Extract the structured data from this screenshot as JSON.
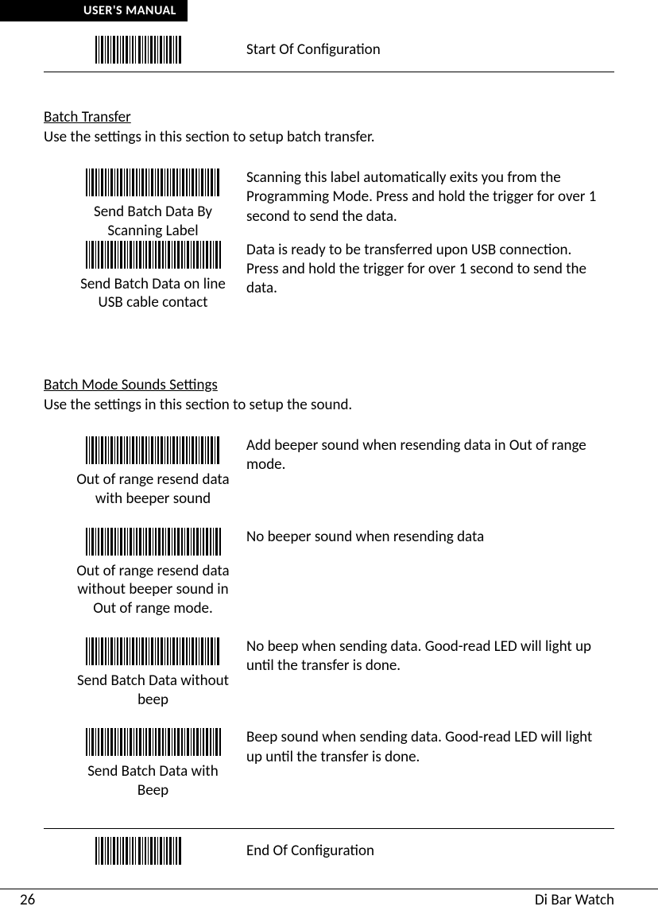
{
  "header": {
    "tab": "USER'S MANUAL"
  },
  "startConfig": {
    "label": "Start Of Configuration"
  },
  "section1": {
    "heading": "Batch Transfer",
    "desc": "Use the settings in this section to setup batch transfer.",
    "items": [
      {
        "caption": "Send Batch Data By Scanning Label",
        "desc": "Scanning this label automatically exits you from the Programming Mode. Press and hold the trigger for over 1 second to send the data."
      },
      {
        "caption": "Send Batch Data on line USB cable contact",
        "desc": "Data is ready to be transferred upon USB connection. Press and hold the trigger for over 1 second to send the data."
      }
    ]
  },
  "section2": {
    "heading": "Batch Mode Sounds Settings",
    "desc": "Use the settings in this section to setup the sound.",
    "items": [
      {
        "caption": "Out of range resend data with beeper sound",
        "desc": "Add beeper sound when resending data in Out of range mode."
      },
      {
        "caption": "Out of range resend data without beeper sound in Out of range mode.",
        "desc": "No beeper sound when resending data"
      },
      {
        "caption": "Send Batch Data without beep",
        "desc": "No beep when sending data. Good-read LED will light up until the transfer is done."
      },
      {
        "caption": "Send Batch Data with Beep",
        "desc": "Beep sound when sending data. Good-read LED will light up until the transfer is done."
      }
    ]
  },
  "endConfig": {
    "label": "End Of Configuration"
  },
  "footer": {
    "pageNumber": "26",
    "docTitle": "Di  Bar  Watch"
  }
}
